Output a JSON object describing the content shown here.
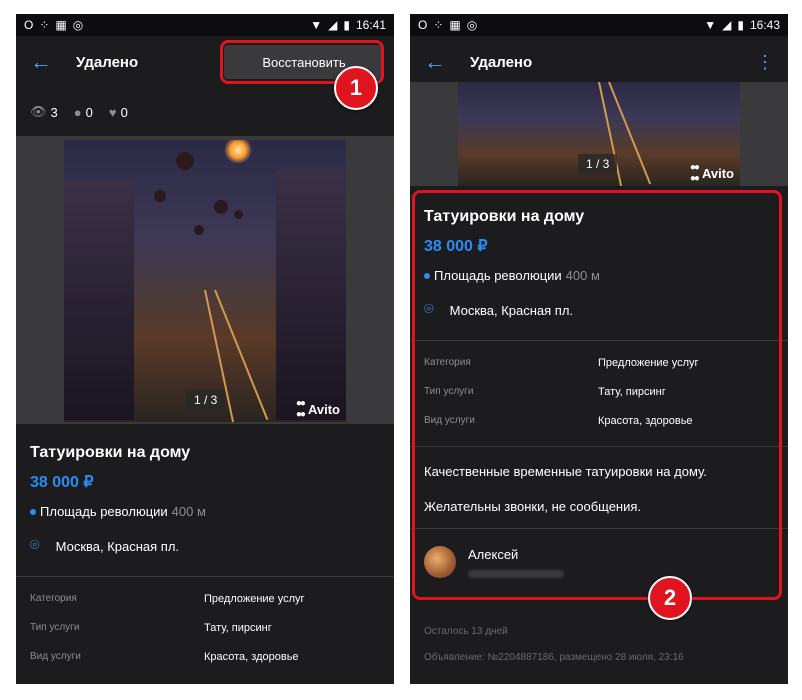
{
  "left": {
    "status": {
      "time": "16:41"
    },
    "toolbar": {
      "title": "Удалено",
      "restore": "Восстановить"
    },
    "stats": {
      "views": "3",
      "contacts": "0",
      "favorites": "0"
    },
    "photo": {
      "counter": "1 / 3",
      "brand": "Avito"
    },
    "ad": {
      "title": "Татуировки на дому",
      "price": "38 000 ₽",
      "metro": "Площадь революции",
      "metro_dist": "400 м",
      "address": "Москва, Красная пл."
    },
    "params": [
      {
        "k": "Категория",
        "v": "Предложение услуг"
      },
      {
        "k": "Тип услуги",
        "v": "Тату, пирсинг"
      },
      {
        "k": "Вид услуги",
        "v": "Красота, здоровье"
      }
    ],
    "badge": "1"
  },
  "right": {
    "status": {
      "time": "16:43"
    },
    "toolbar": {
      "title": "Удалено"
    },
    "photo": {
      "counter": "1 / 3",
      "brand": "Avito"
    },
    "ad": {
      "title": "Татуировки на дому",
      "price": "38 000 ₽",
      "metro": "Площадь революции",
      "metro_dist": "400 м",
      "address": "Москва, Красная пл."
    },
    "params": [
      {
        "k": "Категория",
        "v": "Предложение услуг"
      },
      {
        "k": "Тип услуги",
        "v": "Тату, пирсинг"
      },
      {
        "k": "Вид услуги",
        "v": "Красота, здоровье"
      }
    ],
    "description": [
      "Качественные временные татуировки на дому.",
      "Желательны звонки, не сообщения."
    ],
    "seller": {
      "name": "Алексей"
    },
    "footer": {
      "remaining": "Осталось 13 дней",
      "ad_info": "Объявление: №2204887186, размещено 28 июля, 23:16"
    },
    "badge": "2"
  },
  "colors": {
    "accent": "#2b8cf2",
    "highlight": "#e0141e",
    "background": "#1c1c1e"
  }
}
